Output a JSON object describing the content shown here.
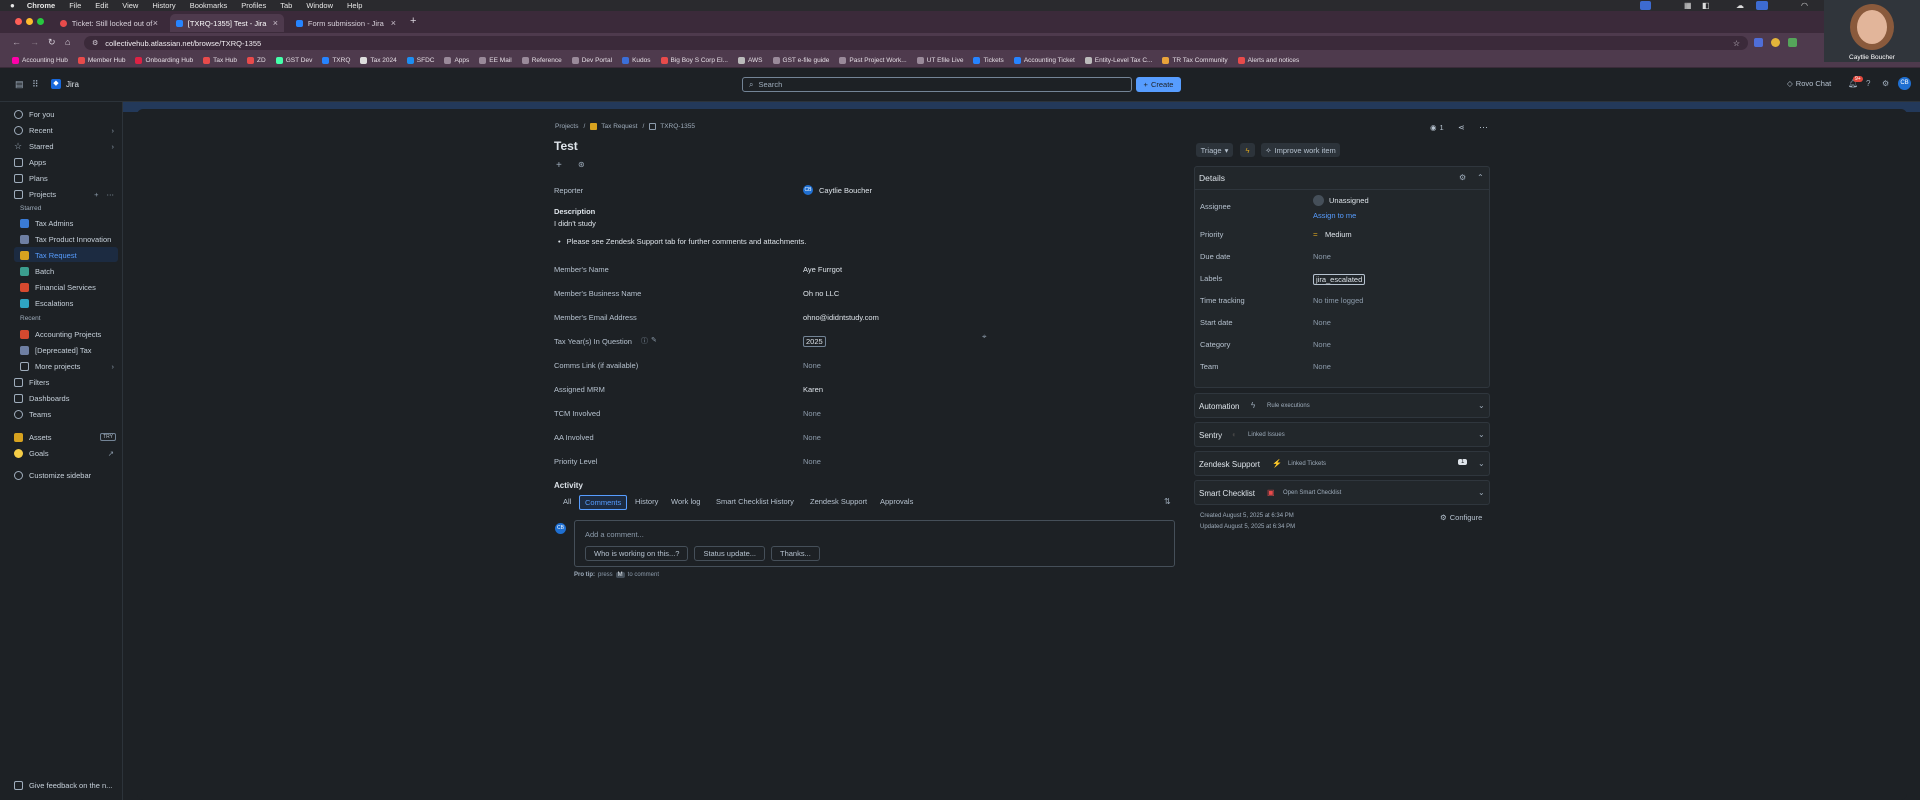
{
  "mac_menu": [
    "Chrome",
    "File",
    "Edit",
    "View",
    "History",
    "Bookmarks",
    "Profiles",
    "Tab",
    "Window",
    "Help"
  ],
  "browser_tabs": [
    {
      "title": "Ticket: Still locked out of Goo"
    },
    {
      "title": "[TXRQ-1355] Test - Jira"
    },
    {
      "title": "Form submission - Jira"
    }
  ],
  "url": "collectivehub.atlassian.net/browse/TXRQ-1355",
  "bookmarks": [
    "Accounting Hub",
    "Member Hub",
    "Onboarding Hub",
    "Tax Hub",
    "ZD",
    "GST Dev",
    "TXRQ",
    "Tax 2024",
    "SFDC",
    "Apps",
    "EE Mail",
    "Reference",
    "Dev Portal",
    "Kudos",
    "Big Boy S Corp El...",
    "AWS",
    "GST e-file guide",
    "Past Project Work...",
    "UT Efile Live",
    "Tickets",
    "Accounting Ticket",
    "Entity-Level Tax C...",
    "TR Tax Community",
    "Alerts and notices"
  ],
  "jira": {
    "app_name": "Jira",
    "search_placeholder": "Search",
    "create_label": "Create",
    "rovo_label": "Rovo Chat",
    "notif_count": "9+",
    "avatar_initials": "CB"
  },
  "webcam_label": "Caytlie Boucher",
  "sidebar": {
    "items": [
      "For you",
      "Recent",
      "Starred",
      "Apps",
      "Plans",
      "Projects"
    ],
    "starred_label": "Starred",
    "starred": [
      "Tax Admins",
      "Tax Product Innovation",
      "Tax Request",
      "Batch",
      "Financial Services",
      "Escalations"
    ],
    "recent_label": "Recent",
    "recent": [
      "Accounting Projects",
      "[Deprecated] Tax",
      "More projects"
    ],
    "bottom": [
      "Filters",
      "Dashboards",
      "Teams",
      "Assets",
      "Goals",
      "Customize sidebar"
    ],
    "assets_badge": "TRY",
    "feedback": "Give feedback on the n..."
  },
  "issue": {
    "breadcrumb": [
      "Projects",
      "Tax Request",
      "TXRQ-1355"
    ],
    "title": "Test",
    "reporter_label": "Reporter",
    "reporter": "Caytlie Boucher",
    "reporter_initials": "CB",
    "description_label": "Description",
    "description": "I didn't study",
    "bullet": "Please see Zendesk Support tab for further comments and attachments.",
    "fields": [
      {
        "label": "Member's Name",
        "value": "Aye Furrgot"
      },
      {
        "label": "Member's Business Name",
        "value": "Oh no LLC"
      },
      {
        "label": "Member's Email Address",
        "value": "ohno@ididntstudy.com"
      },
      {
        "label": "Tax Year(s) In Question",
        "value": "2025"
      },
      {
        "label": "Comms Link (if available)",
        "value": "None"
      },
      {
        "label": "Assigned MRM",
        "value": "Karen"
      },
      {
        "label": "TCM Involved",
        "value": "None"
      },
      {
        "label": "AA Involved",
        "value": "None"
      },
      {
        "label": "Priority Level",
        "value": "None"
      }
    ],
    "activity_label": "Activity",
    "activity_tabs": [
      "All",
      "Comments",
      "History",
      "Work log",
      "Smart Checklist History",
      "Zendesk Support",
      "Approvals"
    ],
    "comment_placeholder": "Add a comment...",
    "quick_replies": [
      "Who is working on this...?",
      "Status update...",
      "Thanks..."
    ],
    "pro_tip_prefix": "Pro tip:",
    "pro_tip_press": "press",
    "pro_tip_key": "M",
    "pro_tip_suffix": "to comment"
  },
  "right": {
    "watch_count": "1",
    "status": "Triage",
    "improve": "Improve work item",
    "details_label": "Details",
    "rows": [
      {
        "label": "Assignee",
        "value": "Unassigned"
      },
      {
        "label": "Priority",
        "value": "Medium"
      },
      {
        "label": "Due date",
        "value": "None"
      },
      {
        "label": "Labels",
        "value": "jira_escalated"
      },
      {
        "label": "Time tracking",
        "value": "No time logged"
      },
      {
        "label": "Start date",
        "value": "None"
      },
      {
        "label": "Category",
        "value": "None"
      },
      {
        "label": "Team",
        "value": "None"
      }
    ],
    "assign_to_me": "Assign to me",
    "sections": [
      {
        "title": "Automation",
        "sub": "Rule executions"
      },
      {
        "title": "Sentry",
        "sub": "Linked Issues"
      },
      {
        "title": "Zendesk Support",
        "sub": "Linked Tickets",
        "badge": "1"
      },
      {
        "title": "Smart Checklist",
        "sub": "Open Smart Checklist"
      }
    ],
    "created": "Created August 5, 2025 at 6:34 PM",
    "updated": "Updated August 5, 2025 at 6:34 PM",
    "configure": "Configure"
  },
  "colors": {
    "accent": "#579dff",
    "sidebar_selected": "#1c2b41",
    "banner": "#23395a"
  }
}
